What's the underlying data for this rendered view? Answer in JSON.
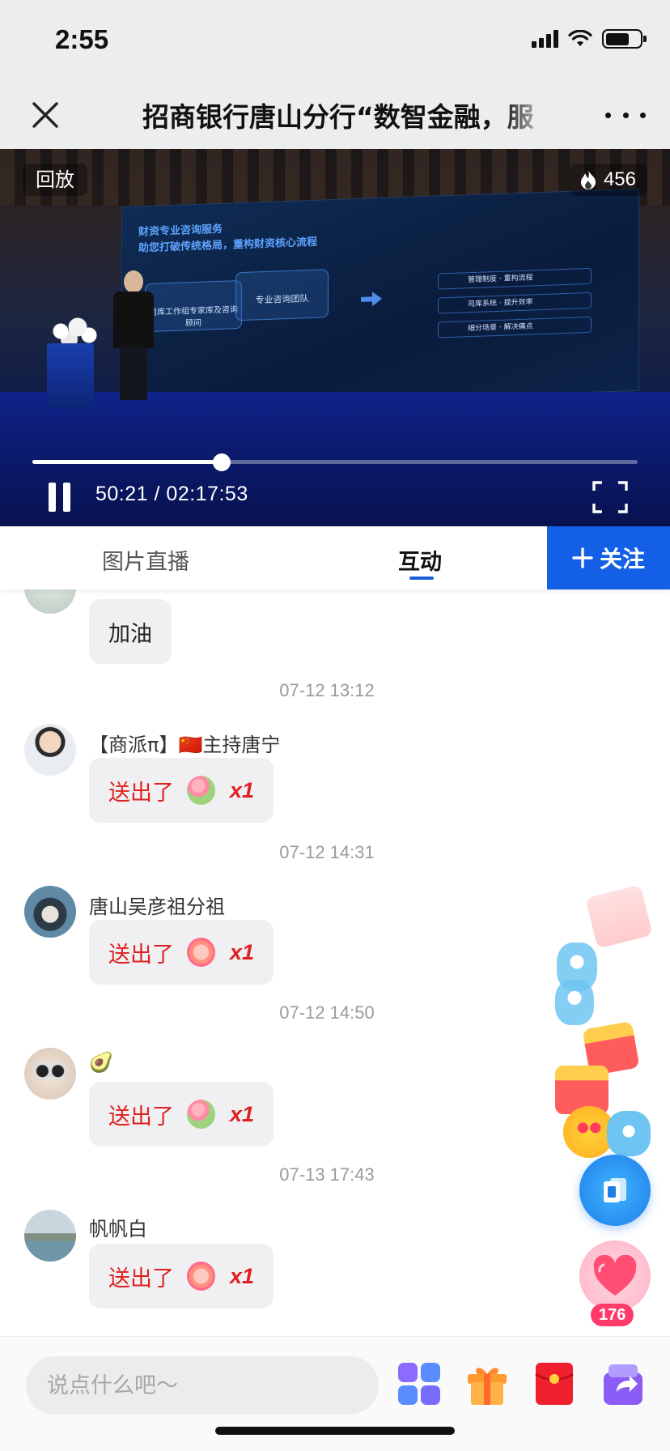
{
  "status_bar": {
    "time": "2:55"
  },
  "nav": {
    "title": "招商银行唐山分行“数智金融，服"
  },
  "video": {
    "replay_label": "回放",
    "heat_count": "456",
    "progress_fraction": 0.313,
    "current_time": "50:21",
    "separator": "/",
    "total_time": "02:17:53",
    "screen_title_line1": "财资专业咨询服务",
    "screen_title_line2": "助您打破传统格局，重构财资核心流程",
    "screen_box1": "司库工作组专家库及咨询顾问",
    "screen_box2": "专业咨询团队",
    "screen_rows": [
      "管理制度 · 重构流程",
      "司库系统 · 提升效率",
      "细分场景 · 解决痛点"
    ]
  },
  "tabs": {
    "items": [
      "图片直播",
      "互动"
    ],
    "active_index": 1,
    "follow_label": "关注"
  },
  "chat": {
    "messages": [
      {
        "type": "text",
        "name": "",
        "text": "加油"
      },
      {
        "type": "timestamp",
        "text": "07-12 13:12"
      },
      {
        "type": "gift",
        "name": "【商派π】🇨🇳主持唐宁",
        "text": "送出了",
        "qty": "x1",
        "gift": "bouquet"
      },
      {
        "type": "timestamp",
        "text": "07-12 14:31"
      },
      {
        "type": "gift",
        "name": "唐山吴彦祖分祖",
        "text": "送出了",
        "qty": "x1",
        "gift": "clap"
      },
      {
        "type": "timestamp",
        "text": "07-12 14:50"
      },
      {
        "type": "gift",
        "name": "🥑",
        "text": "送出了",
        "qty": "x1",
        "gift": "bouquet"
      },
      {
        "type": "timestamp",
        "text": "07-13 17:43"
      },
      {
        "type": "gift",
        "name": "帆帆白",
        "text": "送出了",
        "qty": "x1",
        "gift": "clap"
      }
    ]
  },
  "like": {
    "count": "176"
  },
  "bottom": {
    "placeholder": "说点什么吧～"
  },
  "colors": {
    "accent": "#1360e6",
    "gift_text": "#e02020",
    "like": "#ff3b6b"
  }
}
